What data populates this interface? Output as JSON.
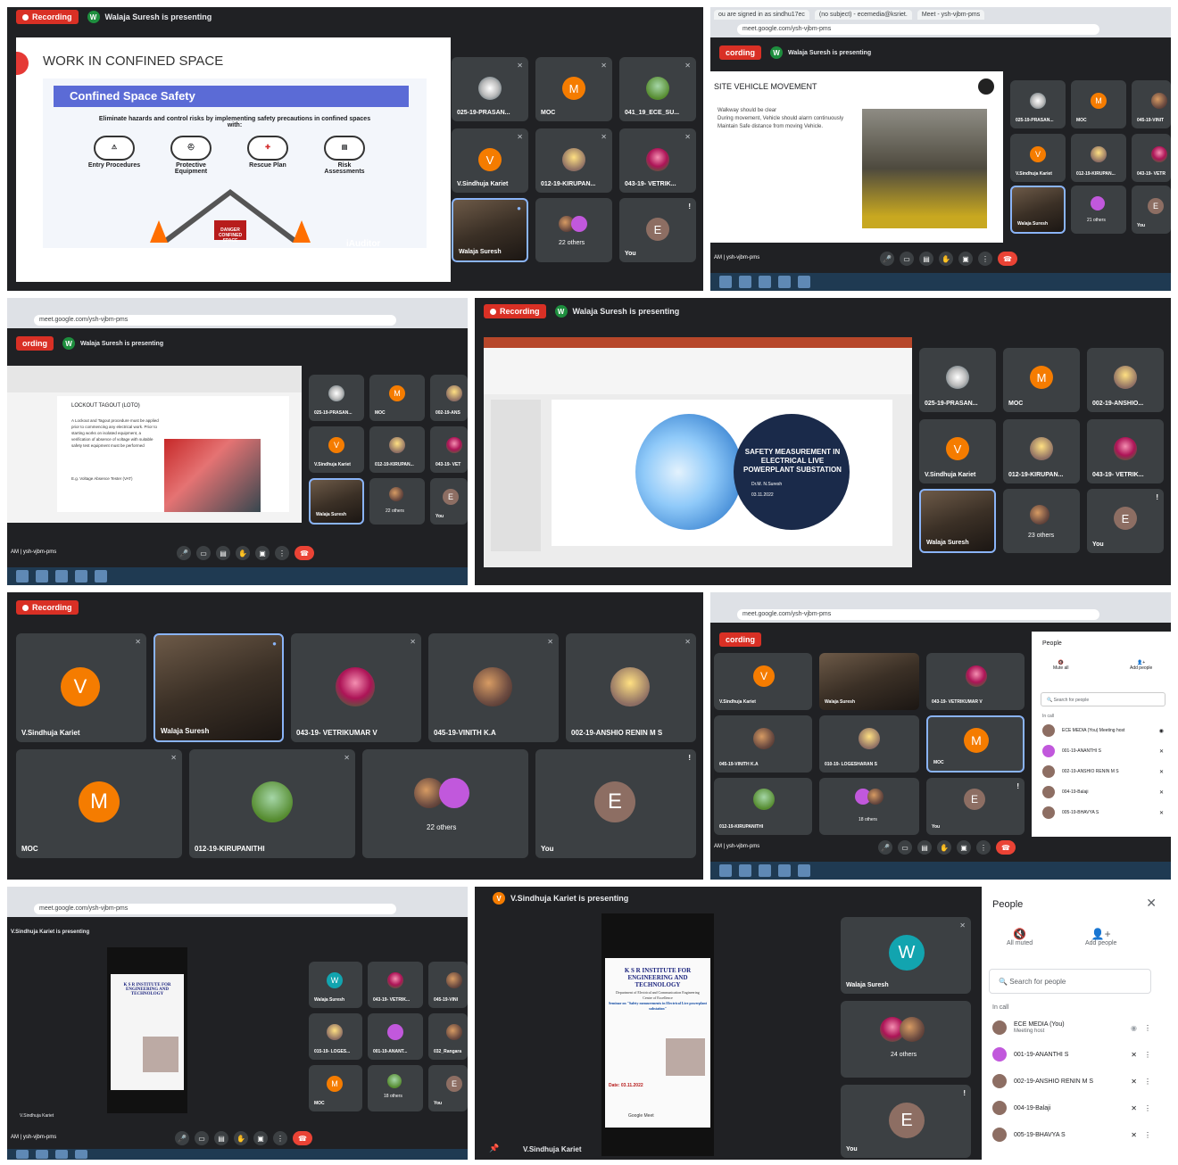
{
  "panel1": {
    "recording": "Recording",
    "presenter": "Walaja Suresh is presenting",
    "slide_title": "WORK IN CONFINED SPACE",
    "banner": "Confined Space Safety",
    "subtitle": "Eliminate hazards and control risks by implementing safety precautions in confined spaces with:",
    "items": [
      "Entry Procedures",
      "Protective Equipment",
      "Rescue Plan",
      "Risk Assessments"
    ],
    "danger": "DANGER CONFINED SPACE",
    "brand": "iAuditor",
    "tiles": [
      "025-19-PRASAN...",
      "MOC",
      "041_19_ECE_SU...",
      "V.Sindhuja Kariet",
      "012-19-KIRUPAN...",
      "043-19- VETRIK...",
      "Walaja Suresh",
      "22 others",
      "You"
    ]
  },
  "panel2": {
    "tabs": [
      "ou are signed in as sindhu17ec",
      "(no subject) - ecemedia@ksriet.",
      "Meet - ysh-vjbm-pms"
    ],
    "url": "meet.google.com/ysh-vjbm-pms",
    "recording": "cording",
    "presenter": "Walaja Suresh is presenting",
    "slide_title": "SITE VEHICLE MOVEMENT",
    "bullets": [
      "Walkway should be clear",
      "During movement, Vehicle should alarm continuously",
      "Maintain Safe distance from moving Vehicle."
    ],
    "tiles": [
      "025-19-PRASAN...",
      "MOC",
      "045-19-VINIT",
      "V.Sindhuja Kariet",
      "012-19-KIRUPAN...",
      "043-19- VETR",
      "Walaja Suresh",
      "21 others",
      "You"
    ],
    "meeting": "AM | ysh-vjbm-pms"
  },
  "panel3": {
    "url": "meet.google.com/ysh-vjbm-pms",
    "recording": "ording",
    "presenter": "Walaja Suresh is presenting",
    "slide_title": "LOCKOUT TAGOUT (LOTO)",
    "body": "A Lockout and Tagout procedure must be applied prior to commencing any electrical work. Prior to starting works on isolated equipment, a verification of absence of voltage with suitable safety test equipment must be performed",
    "example": "E.g. Voltage Absence Tester (VAT)",
    "tiles": [
      "025-19-PRASAN...",
      "MOC",
      "002-19-ANS",
      "V.Sindhuja Kariet",
      "012-19-KIRUPAN...",
      "043-19- VET",
      "Walaja Suresh",
      "22 others",
      "You"
    ],
    "meeting": "AM | ysh-vjbm-pms"
  },
  "panel4": {
    "recording": "Recording",
    "presenter": "Walaja Suresh is presenting",
    "slide_title": "SAFETY MEASUREMENT IN ELECTRICAL LIVE POWERPLANT SUBSTATION",
    "author": "Dr.M. N.Suresh",
    "date": "03.11.2022",
    "tiles": [
      "025-19-PRASAN...",
      "MOC",
      "002-19-ANSHIO...",
      "V.Sindhuja Kariet",
      "012-19-KIRUPAN...",
      "043-19- VETRIK...",
      "Walaja Suresh",
      "23 others",
      "You"
    ]
  },
  "panel5": {
    "recording": "Recording",
    "tiles": [
      "V.Sindhuja Kariet",
      "Walaja Suresh",
      "043-19- VETRIKUMAR V",
      "045-19-VINITH K.A",
      "002-19-ANSHIO RENIN M S",
      "MOC",
      "012-19-KIRUPANITHI",
      "22 others",
      "You"
    ]
  },
  "panel6": {
    "url": "meet.google.com/ysh-vjbm-pms",
    "recording": "cording",
    "tiles": [
      "V.Sindhuja Kariet",
      "Walaja Suresh",
      "043-19- VETRIKUMAR V",
      "045-19-VINITH K.A",
      "010-19- LOGESHARAN S",
      "MOC",
      "012-19-KIRUPANITHI",
      "18 others",
      "You"
    ],
    "people_title": "People",
    "mute_all": "Mute all",
    "add_people": "Add people",
    "search": "Search for people",
    "in_call": "In call",
    "participants": [
      "ECE MEDIA (You) Meeting host",
      "001-19-ANANTHI S",
      "002-19-ANSHIO RENIN M S",
      "004-19-Balaji",
      "005-19-BHAVYA S"
    ],
    "meeting": "AM | ysh-vjbm-pms"
  },
  "panel7": {
    "url": "meet.google.com/ysh-vjbm-pms",
    "presenter": "V.Sindhuja Kariet is presenting",
    "poster_title": "K S R INSTITUTE FOR ENGINEERING AND TECHNOLOGY",
    "tiles": [
      "Walaja Suresh",
      "043-19- VETRIK...",
      "045-19-VINI",
      "015-19- LOGES...",
      "001-19-ANANT...",
      "032_Rangara",
      "MOC",
      "18 others",
      "You"
    ],
    "self": "V.Sindhuja Kariet",
    "meeting": "AM | ysh-vjbm-pms"
  },
  "panel8": {
    "presenter": "V.Sindhuja Kariet is presenting",
    "poster_title": "K S R INSTITUTE FOR ENGINEERING AND TECHNOLOGY",
    "poster_lines": [
      "Department of Electrical and Communication Engineering",
      "Centre of Excellence",
      "Seminar on \"Safety measurements in Electrical Live powerplant substation\"",
      "Date: 03.11.2022",
      "Google Meet"
    ],
    "tiles": [
      "Walaja Suresh",
      "24 others",
      "You"
    ],
    "people_title": "People",
    "all_muted": "All muted",
    "add_people": "Add people",
    "search": "Search for people",
    "in_call": "In call",
    "participants": [
      "ECE MEDIA (You)",
      "001-19-ANANTHI S",
      "002-19-ANSHIO RENIN M S",
      "004-19-Balaji",
      "005-19-BHAVYA S"
    ],
    "host": "Meeting host",
    "bottom_name": "V.Sindhuja Kariet"
  }
}
